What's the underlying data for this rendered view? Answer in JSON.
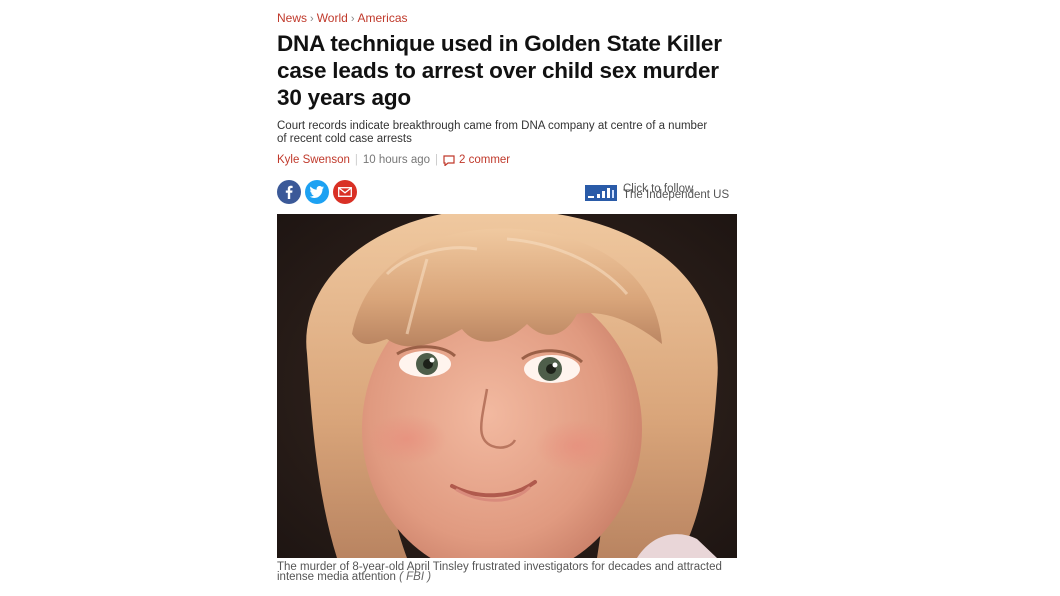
{
  "breadcrumb": [
    "News",
    "World",
    "Americas"
  ],
  "headline": "DNA technique used in Golden State Killer case leads to arrest over child sex murder 30 years ago",
  "standfirst": "Court records indicate breakthrough came from DNA company at centre of a number of recent cold case arrests",
  "byline": {
    "author": "Kyle Swenson",
    "time": "10 hours ago",
    "comments": "2 commer"
  },
  "share": {
    "facebook_icon": "facebook-icon",
    "twitter_icon": "twitter-icon",
    "email_icon": "email-icon"
  },
  "follow": {
    "line1": "Click to follow",
    "line2": "The Independent US"
  },
  "photo": {
    "caption": "The murder of 8-year-old April Tinsley frustrated investigators for decades and attracted intense media attention",
    "credit": "( FBI )"
  },
  "colors": {
    "accent": "#c0392b",
    "facebook": "#3b5998",
    "twitter": "#1da1f2",
    "email": "#d93025"
  }
}
